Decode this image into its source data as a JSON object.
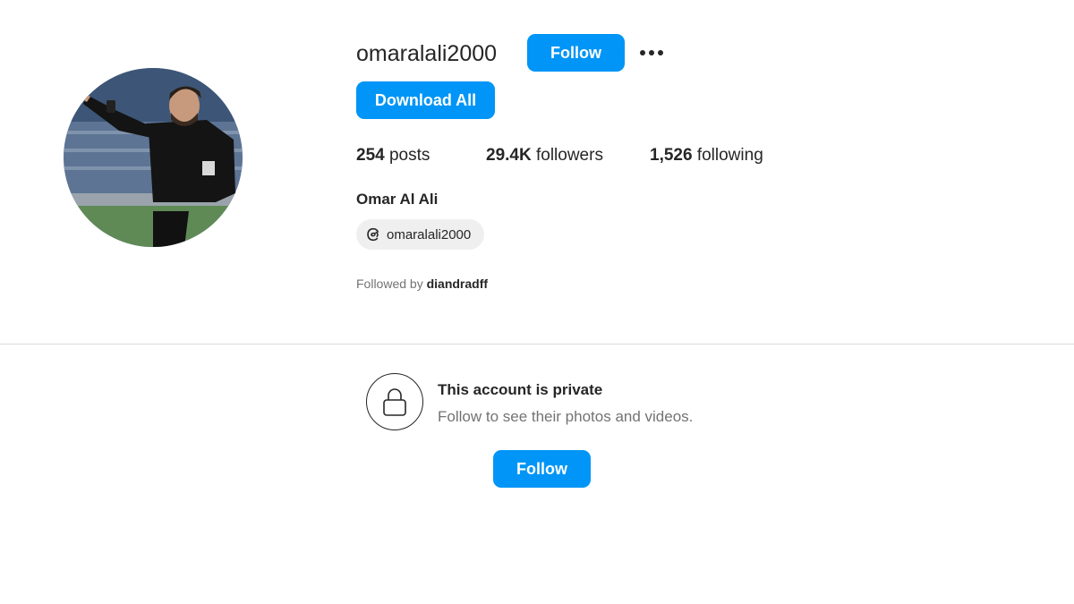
{
  "profile": {
    "username": "omaralali2000",
    "full_name": "Omar Al Ali",
    "follow_label": "Follow",
    "download_all_label": "Download All",
    "more_icon": "more-horizontal-icon",
    "stats": {
      "posts_count": "254",
      "posts_label": "posts",
      "followers_count": "29.4K",
      "followers_label": "followers",
      "following_count": "1,526",
      "following_label": "following"
    },
    "threads": {
      "icon": "threads-icon",
      "handle": "omaralali2000"
    },
    "followed_by": {
      "prefix": "Followed by",
      "user": "diandradff"
    }
  },
  "private": {
    "icon": "lock-icon",
    "title": "This account is private",
    "subtitle": "Follow to see their photos and videos.",
    "follow_label": "Follow"
  },
  "colors": {
    "accent": "#0095f6",
    "text": "#262626",
    "muted": "#737373",
    "pill": "#efefef",
    "divider": "#dbdbdb"
  }
}
